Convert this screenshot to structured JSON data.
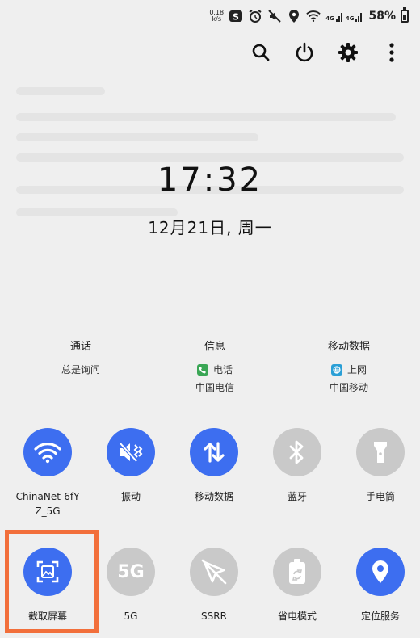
{
  "status_bar": {
    "net_speed_value": "0.18",
    "net_speed_unit": "k/s",
    "signal_1": "4G",
    "signal_2": "4G",
    "battery_pct": "58%",
    "battery_level": 0.58
  },
  "clock": {
    "time": "17:32",
    "date": "12月21日, 周一"
  },
  "info": {
    "call": {
      "title": "通话",
      "value": "总是询问"
    },
    "sms": {
      "title": "信息",
      "app": "电话",
      "carrier": "中国电信"
    },
    "data": {
      "title": "移动数据",
      "app": "上网",
      "carrier": "中国移动"
    }
  },
  "tiles_row1": [
    {
      "label": "ChinaNet-6fY",
      "label2": "Z_5G",
      "state": "on",
      "icon": "wifi-icon"
    },
    {
      "label": "振动",
      "state": "on",
      "icon": "vibrate-icon"
    },
    {
      "label": "移动数据",
      "state": "on",
      "icon": "data-arrows-icon"
    },
    {
      "label": "蓝牙",
      "state": "off",
      "icon": "bluetooth-icon"
    },
    {
      "label": "手电筒",
      "state": "off",
      "icon": "flashlight-icon"
    }
  ],
  "tiles_row2": [
    {
      "label": "截取屏幕",
      "state": "on",
      "icon": "screenshot-icon"
    },
    {
      "label": "5G",
      "icon_text": "5G",
      "state": "off",
      "icon": "5g-icon"
    },
    {
      "label": "SSRR",
      "state": "off",
      "icon": "ssrr-icon"
    },
    {
      "label": "省电模式",
      "state": "off",
      "icon": "battery-saver-icon"
    },
    {
      "label": "定位服务",
      "state": "on",
      "icon": "location-icon"
    }
  ],
  "colors": {
    "accent": "#3d6ef0",
    "inactive": "#c9c9c9",
    "highlight": "#f26f3b"
  }
}
